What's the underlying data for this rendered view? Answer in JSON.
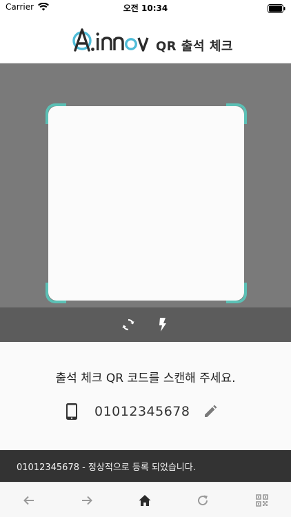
{
  "status_bar": {
    "carrier": "Carrier",
    "time": "오전 10:34"
  },
  "header": {
    "logo_text": "A.innov",
    "title": "QR 출석 체크"
  },
  "scanner": {
    "frame_color": "#5bc0b5"
  },
  "camera_controls": {
    "switch_icon": "camera-switch-icon",
    "flash_icon": "flash-icon"
  },
  "info": {
    "instruction": "출석 체크 QR 코드를 스캔해 주세요.",
    "phone_number": "01012345678"
  },
  "message": {
    "text": "01012345678 - 정상적으로 등록 되었습니다."
  },
  "toolbar": {
    "items": [
      "back-arrow-icon",
      "forward-arrow-icon",
      "home-icon",
      "reload-icon",
      "qr-code-icon"
    ]
  },
  "colors": {
    "accent": "#5bc0b5",
    "brand_dark": "#2b2b2b",
    "scanner_bg": "#7a7a7a",
    "controls_bg": "#5c5c5c",
    "message_bg": "#333333"
  }
}
